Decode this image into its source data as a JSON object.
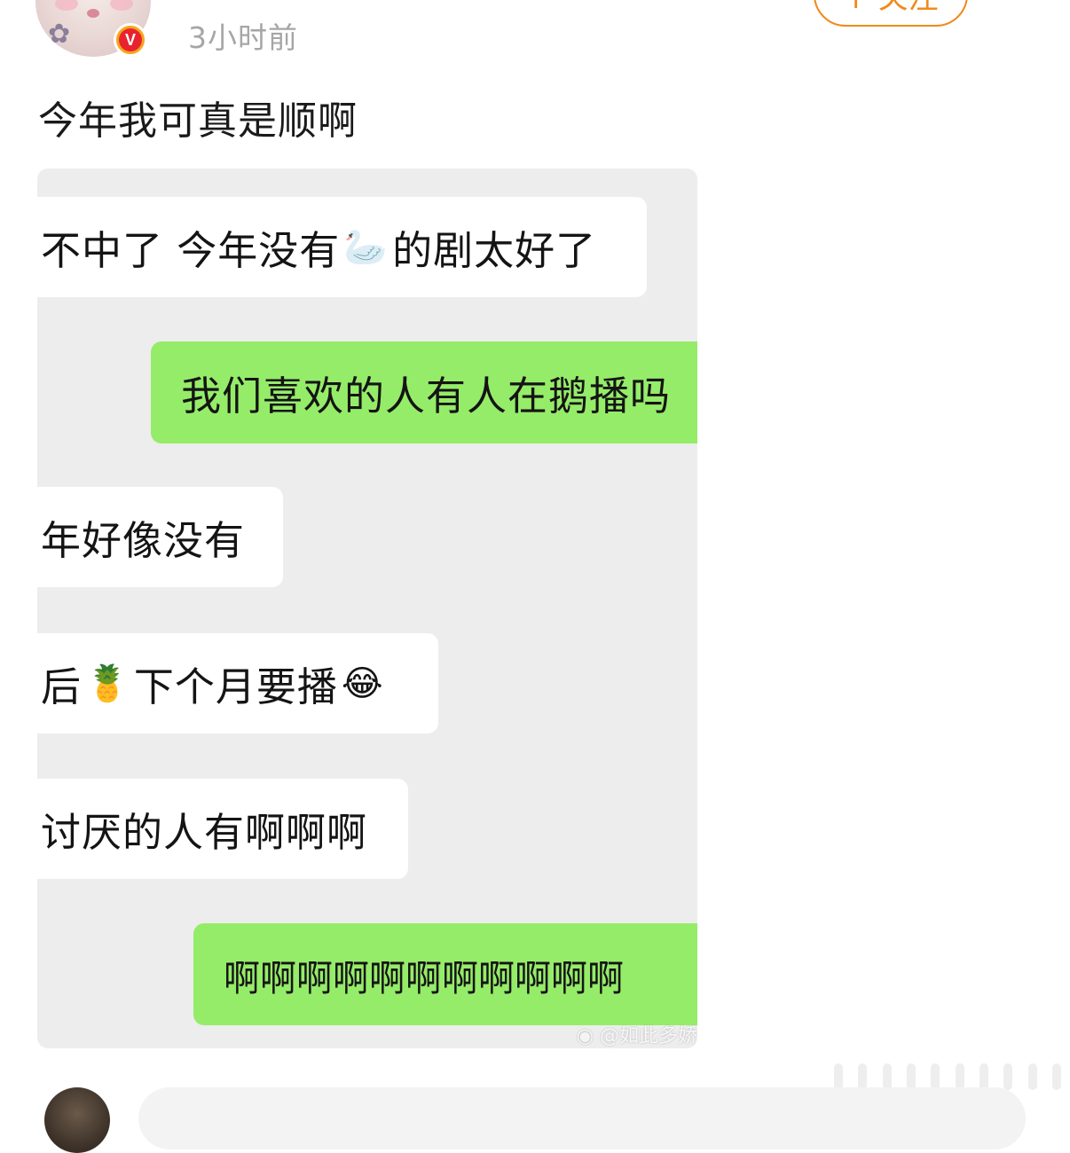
{
  "header": {
    "timestamp": "3小时前",
    "follow_label": "+ 关注",
    "verified_badge": "V"
  },
  "post": {
    "text": "今年我可真是顺啊"
  },
  "chat_image": {
    "messages": [
      {
        "side": "left",
        "parts": [
          "不中了 今年没有",
          "🦢",
          "的剧太好了"
        ]
      },
      {
        "side": "right",
        "parts": [
          "我们喜欢的人有人在鹅播吗"
        ]
      },
      {
        "side": "left",
        "parts": [
          "年好像没有"
        ]
      },
      {
        "side": "left",
        "parts": [
          "后",
          "🍍",
          "下个月要播",
          "😂"
        ]
      },
      {
        "side": "left",
        "parts": [
          "讨厌的人有啊啊啊"
        ]
      },
      {
        "side": "right",
        "parts": [
          "啊啊啊啊啊啊啊啊啊啊啊"
        ]
      }
    ],
    "watermark": "@如此多娇",
    "colors": {
      "background": "#ededed",
      "incoming_bubble": "#ffffff",
      "outgoing_bubble": "#95ec69"
    }
  },
  "icons": {
    "avatar": "user-avatar",
    "verified": "verified-badge-icon",
    "swan": "swan-emoji",
    "pineapple": "pineapple-emoji",
    "laugh": "tears-of-joy-emoji",
    "weibo": "weibo-logo-icon"
  },
  "colors": {
    "accent": "#f08a1c",
    "timestamp": "#a6a6a6",
    "verified_red": "#e8232e",
    "verified_orange": "#f7a51c"
  }
}
